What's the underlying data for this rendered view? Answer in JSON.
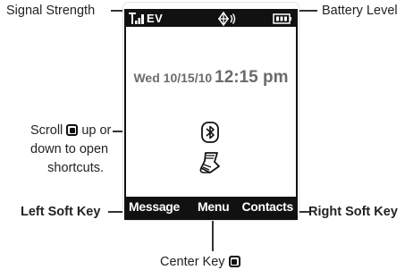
{
  "status_bar": {
    "network": "EV",
    "signal_icon": "signal-strength-icon",
    "location_icon": "gps-location-icon",
    "battery_icon": "battery-level-icon"
  },
  "home_screen": {
    "date": "Wed 10/15/10",
    "time": "12:15 pm",
    "shortcut_icons": [
      "bluetooth-icon",
      "scroll-map-icon"
    ]
  },
  "soft_keys": {
    "left": "Message",
    "center": "Menu",
    "right": "Contacts"
  },
  "callouts": {
    "signal_strength": "Signal Strength",
    "battery_level": "Battery Level",
    "scroll_line1_prefix": "Scroll",
    "scroll_line1_suffix": "up or",
    "scroll_line2": "down to open",
    "scroll_line3": "shortcuts.",
    "left_soft_key": "Left Soft Key",
    "right_soft_key": "Right Soft Key",
    "center_key": "Center Key"
  }
}
